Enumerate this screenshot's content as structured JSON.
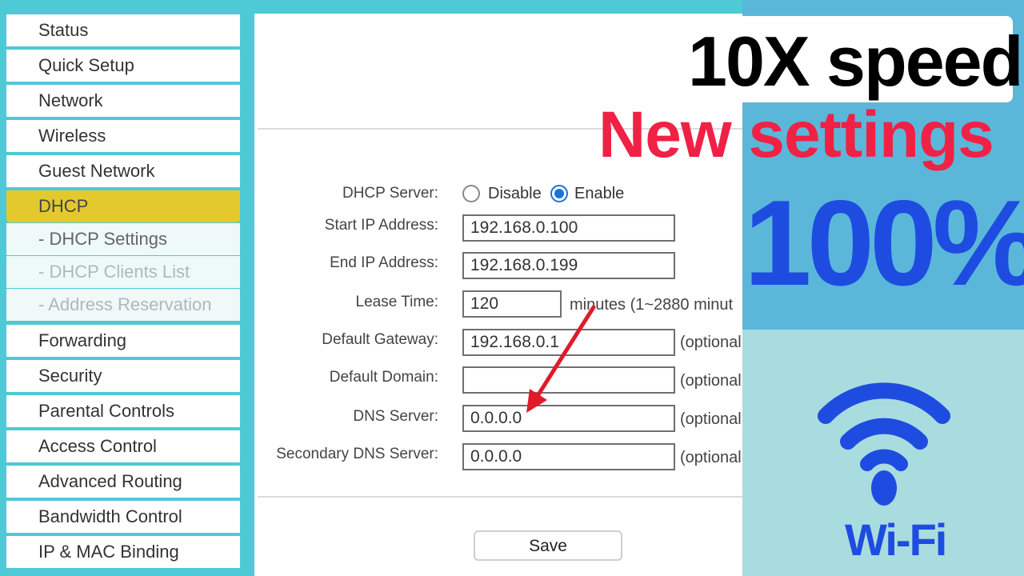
{
  "sidebar": {
    "items": [
      {
        "label": "Status"
      },
      {
        "label": "Quick Setup"
      },
      {
        "label": "Network"
      },
      {
        "label": "Wireless"
      },
      {
        "label": "Guest Network"
      },
      {
        "label": "DHCP"
      },
      {
        "label": "Forwarding"
      },
      {
        "label": "Security"
      },
      {
        "label": "Parental Controls"
      },
      {
        "label": "Access Control"
      },
      {
        "label": "Advanced Routing"
      },
      {
        "label": "Bandwidth Control"
      },
      {
        "label": "IP & MAC Binding"
      }
    ],
    "subitems": [
      {
        "label": "- DHCP Settings"
      },
      {
        "label": "- DHCP Clients List"
      },
      {
        "label": "- Address Reservation"
      }
    ],
    "active_label": "DHCP"
  },
  "form": {
    "dhcp_server_label": "DHCP Server:",
    "disable_label": "Disable",
    "enable_label": "Enable",
    "dhcp_server_value": "Enable",
    "start_ip_label": "Start IP Address:",
    "start_ip_value": "192.168.0.100",
    "end_ip_label": "End IP Address:",
    "end_ip_value": "192.168.0.199",
    "lease_time_label": "Lease Time:",
    "lease_time_value": "120",
    "lease_time_hint": "minutes  (1~2880 minut",
    "gateway_label": "Default Gateway:",
    "gateway_value": "192.168.0.1",
    "domain_label": "Default Domain:",
    "domain_value": "",
    "dns_label": "DNS Server:",
    "dns_value": "0.0.0.0",
    "secondary_dns_label": "Secondary DNS Server:",
    "secondary_dns_value": "0.0.0.0",
    "optional_hint": "(optional",
    "save_label": "Save"
  },
  "promo": {
    "line1": "10X speed",
    "line2": "New settings",
    "line3": "100%",
    "wifi_text": "Wi-Fi"
  },
  "colors": {
    "frame": "#4ec9d6",
    "active_nav": "#e3c92e",
    "headline_red": "#f02145",
    "headline_blue": "#1f4ce0",
    "arrow_red": "#e01a2a"
  },
  "icons": [
    "wifi-icon",
    "red-arrow-icon"
  ]
}
